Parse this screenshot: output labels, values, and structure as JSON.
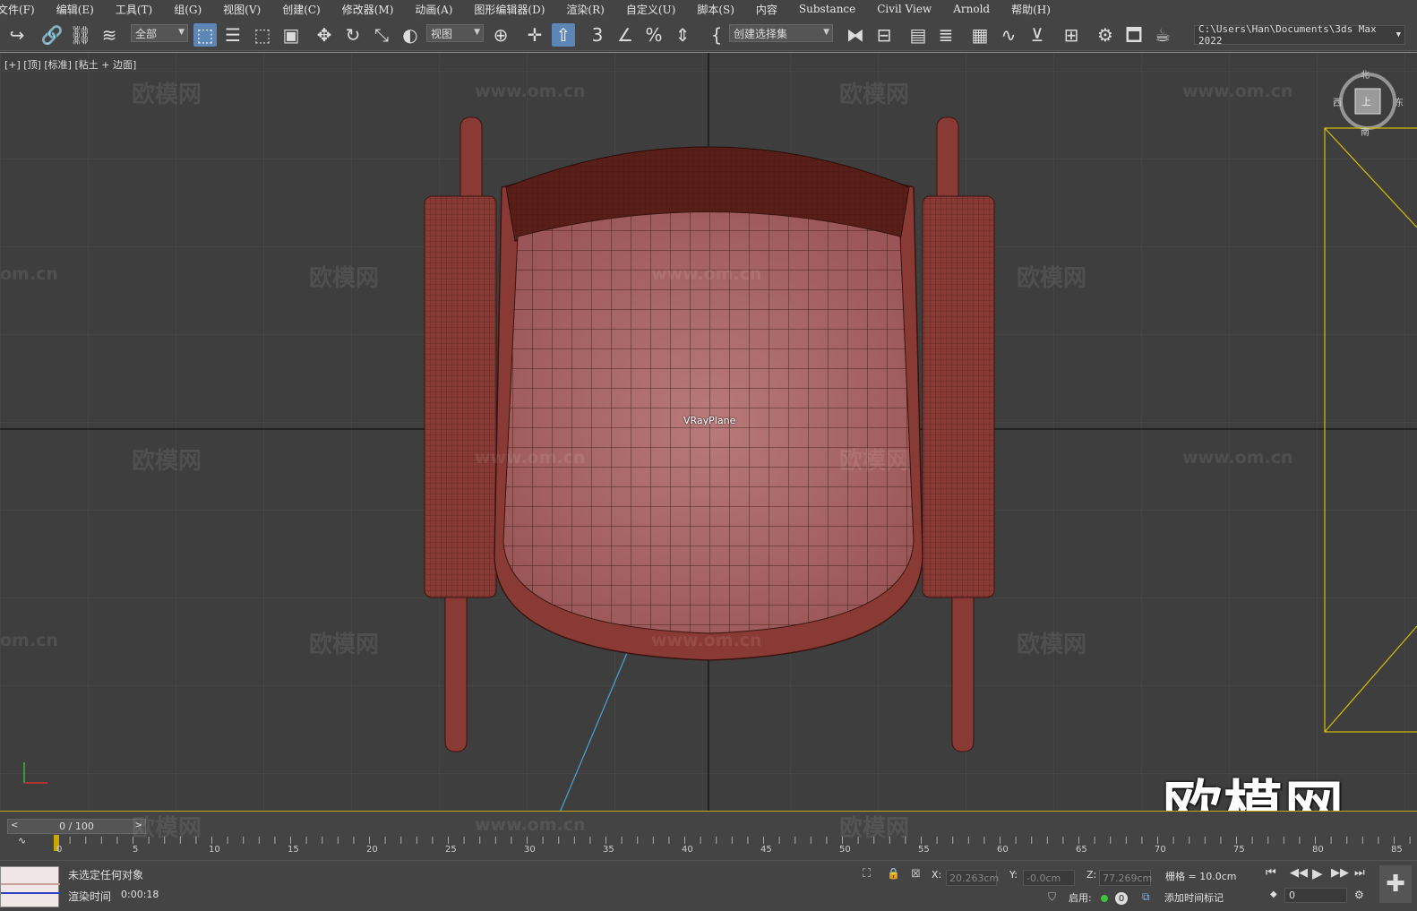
{
  "menu": [
    "文件(F)",
    "编辑(E)",
    "工具(T)",
    "组(G)",
    "视图(V)",
    "创建(C)",
    "修改器(M)",
    "动画(A)",
    "图形编辑器(D)",
    "渲染(R)",
    "自定义(U)",
    "脚本(S)",
    "内容",
    "Substance",
    "Civil View",
    "Arnold",
    "帮助(H)"
  ],
  "toolbar": {
    "filter_value": "全部",
    "coord_system_value": "视图",
    "selection_set_value": "创建选择集",
    "project_path": "C:\\Users\\Han\\Documents\\3ds Max 2022",
    "snap_value": "3"
  },
  "viewport": {
    "label": "[+] [顶] [标准] [粘土 + 边面]",
    "object_label": "VRayPlane",
    "viewcube": {
      "top": "北",
      "bottom": "南",
      "left": "西",
      "right": "东",
      "face": "上"
    },
    "watermark_text": "欧模网",
    "watermark_url": "www.om.cn",
    "watermark_url_partial": "om.cn",
    "big_logo": "欧模网"
  },
  "timeline": {
    "frame_display": "0 / 100",
    "ticks": [
      "0",
      "5",
      "10",
      "15",
      "20",
      "25",
      "30",
      "35",
      "40",
      "45",
      "50",
      "55",
      "60",
      "65",
      "70",
      "75",
      "80",
      "85"
    ]
  },
  "status": {
    "selection_text": "未选定任何对象",
    "render_time_label": "渲染时间",
    "render_time_value": "0:00:18",
    "x_label": "X:",
    "x_value": "20.263cm",
    "y_label": "Y:",
    "y_value": "-0.0cm",
    "z_label": "Z:",
    "z_value": "77.269cm",
    "grid_text": "栅格 = 10.0cm",
    "enable_label": "启用:",
    "enable_count": "0",
    "add_time_tag": "添加时间标记",
    "frame_field": "0"
  },
  "colors": {
    "accent": "#5b86b5",
    "timeline_yellow": "#c8a800",
    "chair": "#8a3a34",
    "seat": "#b06a6a"
  }
}
